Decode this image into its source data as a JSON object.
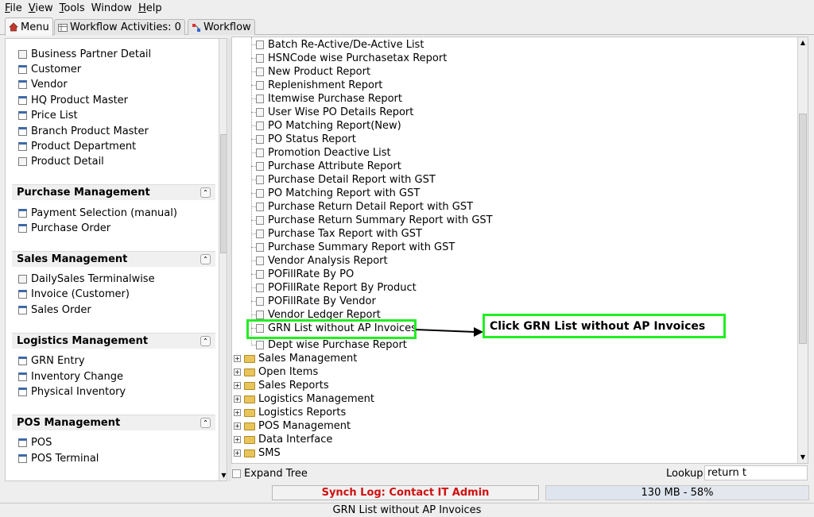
{
  "menubar": {
    "items": [
      {
        "label": "File",
        "mnemonic": "F",
        "rest": "ile"
      },
      {
        "label": "View",
        "mnemonic": "V",
        "rest": "iew"
      },
      {
        "label": "Tools",
        "mnemonic": "T",
        "rest": "ools"
      },
      {
        "label": "Window",
        "mnemonic": "",
        "rest": "Window"
      },
      {
        "label": "Help",
        "mnemonic": "H",
        "rest": "elp"
      }
    ]
  },
  "tabs": {
    "menu": "Menu",
    "workflow_activities": "Workflow Activities: 0",
    "workflow": "Workflow"
  },
  "left": {
    "top_items": [
      "Business Partner Detail",
      "Customer",
      "Vendor",
      "HQ Product Master",
      "Price List",
      "Branch Product Master",
      "Product Department",
      "Product Detail"
    ],
    "groups": [
      {
        "title": "Purchase Management",
        "items": [
          "Payment Selection (manual)",
          "Purchase Order"
        ]
      },
      {
        "title": "Sales Management",
        "items": [
          "DailySales Terminalwise",
          "Invoice (Customer)",
          "Sales Order"
        ]
      },
      {
        "title": "Logistics Management",
        "items": [
          "GRN Entry",
          "Inventory Change",
          "Physical Inventory"
        ]
      },
      {
        "title": "POS Management",
        "items": [
          "POS",
          "POS Terminal"
        ]
      }
    ]
  },
  "tree": {
    "leaves": [
      "Batch Re-Active/De-Active List",
      "HSNCode wise Purchasetax Report",
      "New Product Report",
      "Replenishment Report",
      "Itemwise Purchase Report",
      "User Wise PO Details Report",
      "PO Matching Report(New)",
      "PO Status Report",
      "Promotion Deactive List",
      "Purchase Attribute Report",
      "Purchase Detail Report with GST",
      "PO Matching Report with GST",
      "Purchase Return Detail Report with GST",
      "Purchase Return Summary Report with GST",
      "Purchase Tax Report with GST",
      "Purchase Summary Report with GST",
      "Vendor Analysis Report",
      "POFillRate By PO",
      "POFillRate Report By Product",
      "POFillRate By Vendor",
      "Vendor Ledger Report",
      "GRN List without AP Invoices",
      "Dept wise Purchase Report"
    ],
    "folders": [
      "Sales Management",
      "Open Items",
      "Sales Reports",
      "Logistics Management",
      "Logistics Reports",
      "POS Management",
      "Data Interface",
      "SMS"
    ]
  },
  "callout": {
    "text": "Click GRN List without AP Invoices"
  },
  "bottom": {
    "expand_tree": "Expand Tree",
    "lookup_label": "Lookup",
    "lookup_value": "return t"
  },
  "status": {
    "synch": "Synch Log: Contact IT Admin",
    "memory": "130 MB - 58%",
    "memory_fraction": 0.58,
    "message": "GRN List without AP Invoices"
  },
  "colors": {
    "highlight": "#22ee22",
    "synch_text": "#d01010"
  }
}
